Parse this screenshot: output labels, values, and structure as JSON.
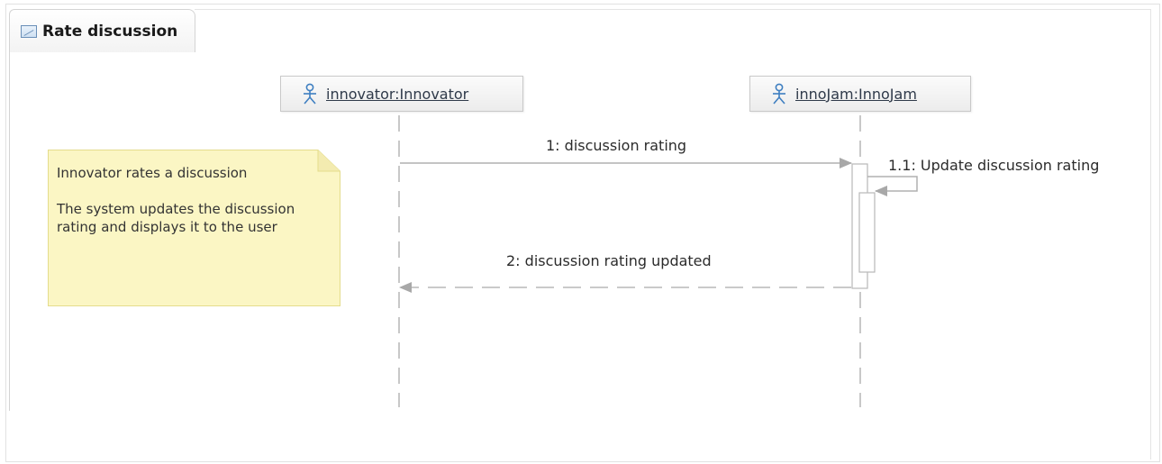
{
  "frame": {
    "title": "Rate discussion",
    "icon": "sequence-diagram-icon"
  },
  "lifelines": [
    {
      "label": "innovator:Innovator",
      "icon": "actor-icon"
    },
    {
      "label": "innoJam:InnoJam",
      "icon": "actor-icon"
    }
  ],
  "note": {
    "line1": "Innovator rates a discussion",
    "line2": "The system updates the discussion rating and displays it to the user"
  },
  "messages": [
    {
      "label": "1: discussion rating"
    },
    {
      "label": "1.1: Update discussion rating"
    },
    {
      "label": "2: discussion rating updated"
    }
  ],
  "colors": {
    "note_fill": "#fbf6c4",
    "note_border": "#e4dc8c",
    "line": "#b0b0b0",
    "actor": "#3f7fc1"
  }
}
